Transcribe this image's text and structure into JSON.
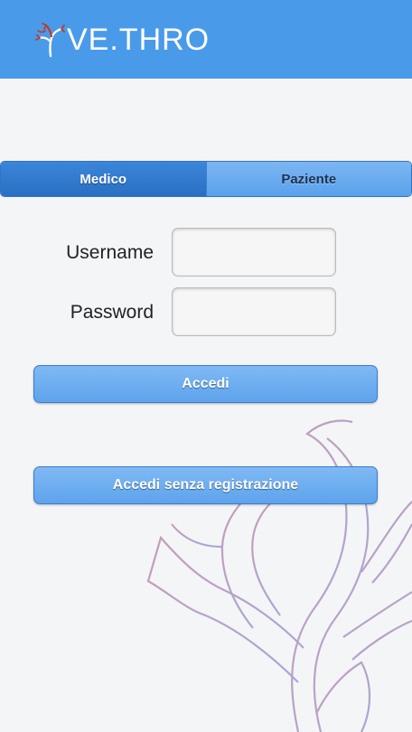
{
  "header": {
    "brand": "VE.THRO",
    "logo_icon": "tree-logo-icon",
    "background_color": "#4a9aea"
  },
  "tabs": [
    {
      "label": "Medico",
      "active": true
    },
    {
      "label": "Paziente",
      "active": false
    }
  ],
  "form": {
    "username_label": "Username",
    "username_value": "",
    "password_label": "Password",
    "password_value": ""
  },
  "buttons": {
    "login_label": "Accedi",
    "guest_login_label": "Accedi senza registrazione"
  },
  "colors": {
    "accent": "#4a9aea",
    "tab_active": "#2f77cc",
    "tab_inactive": "#6eadf0",
    "button": "#6aaaf0",
    "watermark": "#c9a0b8"
  }
}
